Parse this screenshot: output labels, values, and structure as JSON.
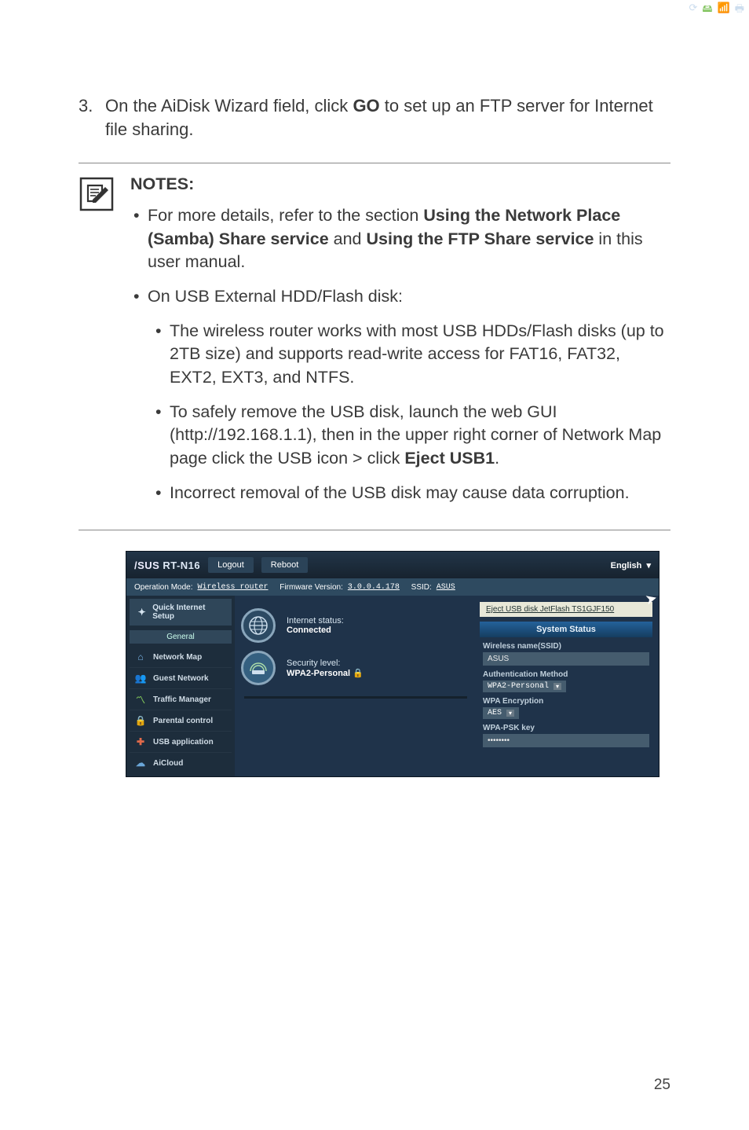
{
  "step": {
    "num": "3.",
    "pre": "On the AiDisk Wizard field, click ",
    "bold": "GO",
    "post": " to set up an FTP server for Internet file sharing."
  },
  "notes": {
    "title": "NOTES",
    "colon": ": ",
    "b1_pre": "For more details, refer to the section ",
    "b1_bold1": "Using the Network Place (Samba) Share service",
    "b1_mid": " and ",
    "b1_bold2": "Using the FTP Share service",
    "b1_post": " in this user manual.",
    "b2": "On USB External HDD/Flash disk:",
    "b2a": "The wireless router works with most USB HDDs/Flash disks (up to 2TB size) and supports read-write access for FAT16, FAT32, EXT2, EXT3, and NTFS.",
    "b2b_pre": "To safely remove the USB disk, launch the web GUI (http://192.168.1.1), then in the upper right corner of Network Map page click the USB icon > click ",
    "b2b_bold": "Eject USB1",
    "b2b_post": ".",
    "b2c": "Incorrect removal of the USB disk may cause data corruption."
  },
  "router": {
    "logo": "/SUS",
    "model": "RT-N16",
    "logout": "Logout",
    "reboot": "Reboot",
    "lang": "English",
    "opmode_label": "Operation Mode: ",
    "opmode_val": "Wireless router",
    "fw_label": "Firmware Version: ",
    "fw_val": "3.0.0.4.178",
    "ssid_label": "SSID: ",
    "ssid_val": "ASUS",
    "eject": "Eject USB disk JetFlash TS1GJF150",
    "qis": "Quick Internet Setup",
    "general": "General",
    "nav": {
      "netmap": "Network Map",
      "guest": "Guest Network",
      "traffic": "Traffic Manager",
      "parental": "Parental control",
      "usb": "USB application",
      "aicloud": "AiCloud"
    },
    "inet_label": "Internet status:",
    "inet_val": "Connected",
    "sec_label": "Security level:",
    "sec_val": "WPA2-Personal",
    "sysstat": "System Status",
    "wname_label": "Wireless name(SSID)",
    "wname_val": "ASUS",
    "auth_label": "Authentication Method",
    "auth_val": "WPA2-Personal",
    "enc_label": "WPA Encryption",
    "enc_val": "AES",
    "psk_label": "WPA-PSK key",
    "psk_val": "••••••••"
  },
  "pagenum": "25"
}
